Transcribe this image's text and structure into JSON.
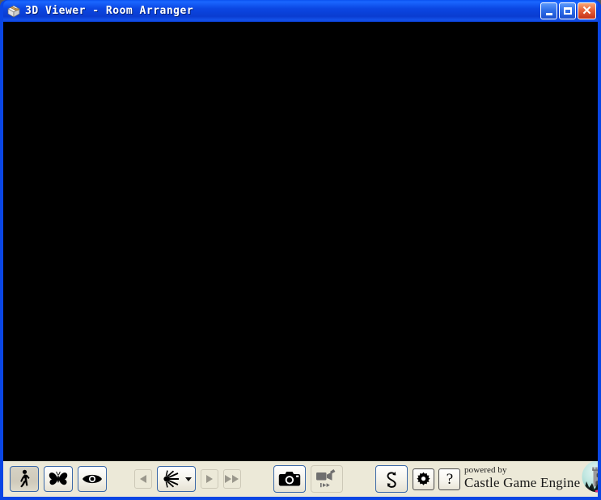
{
  "window": {
    "title": "3D Viewer - Room Arranger",
    "app_icon": "3d-box-icon",
    "frame_color": "#0a46e4",
    "titlebar_color": "#0b46e2",
    "controls": {
      "minimize_label": "Minimize",
      "maximize_label": "Maximize",
      "close_label": "Close"
    }
  },
  "viewport": {
    "name": "3d-render-viewport",
    "background_color": "#000000",
    "content": ""
  },
  "toolbar": {
    "background_color": "#ece9d8",
    "navigation": [
      {
        "id": "walk",
        "icon": "walk-icon",
        "label": "Walk",
        "active": true,
        "enabled": true
      },
      {
        "id": "fly",
        "icon": "butterfly-icon",
        "label": "Fly",
        "active": false,
        "enabled": true
      },
      {
        "id": "examine",
        "icon": "eye-icon",
        "label": "Examine",
        "active": false,
        "enabled": true
      }
    ],
    "animation": [
      {
        "id": "prev",
        "icon": "previous-icon",
        "label": "Previous Animation",
        "enabled": false
      },
      {
        "id": "animation-select",
        "icon": "animation-burst-icon",
        "label": "Animations",
        "enabled": true,
        "has_dropdown": true
      },
      {
        "id": "play",
        "icon": "play-icon",
        "label": "Play",
        "enabled": false
      },
      {
        "id": "forward",
        "icon": "fast-forward-icon",
        "label": "Fast Forward",
        "enabled": false
      }
    ],
    "capture": [
      {
        "id": "screenshot",
        "icon": "camera-icon",
        "label": "Screenshot",
        "enabled": true
      },
      {
        "id": "record-video",
        "icon": "video-camera-icon",
        "label": "Record Video",
        "enabled": false
      }
    ],
    "actions": [
      {
        "id": "reset",
        "icon": "reload-icon",
        "label": "Reset View",
        "enabled": true
      },
      {
        "id": "settings",
        "icon": "gear-icon",
        "label": "Preferences",
        "enabled": true
      },
      {
        "id": "help",
        "icon": "question-mark-icon",
        "label": "Help",
        "enabled": true
      }
    ]
  },
  "branding": {
    "powered_by": "powered by",
    "engine_name": "Castle Game Engine",
    "logo_icon": "castle-tower-logo",
    "logo_circle_color": "#bfe6e0"
  }
}
